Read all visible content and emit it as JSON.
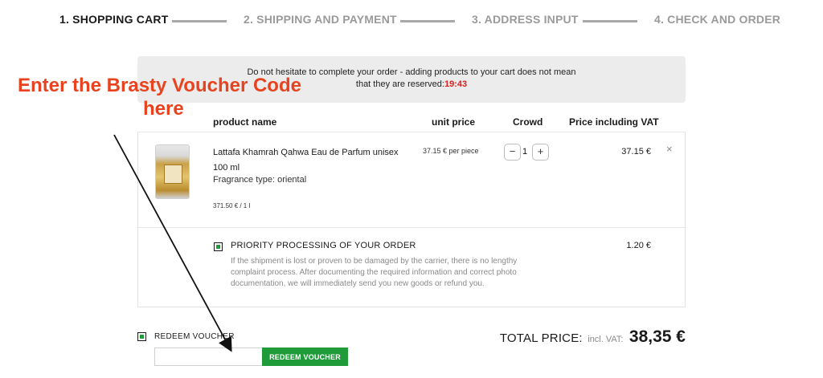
{
  "steps": [
    {
      "label": "1. SHOPPING CART"
    },
    {
      "label": "2. SHIPPING AND PAYMENT"
    },
    {
      "label": "3. ADDRESS INPUT"
    },
    {
      "label": "4. CHECK AND ORDER"
    }
  ],
  "notice": {
    "line1": "Do not hesitate to complete your order - adding products to your cart does not mean",
    "line2": "that they are reserved:",
    "timer": "19:43"
  },
  "annotation": {
    "line1": "Enter the Brasty Voucher Code",
    "line2": "here"
  },
  "table_headers": {
    "product_name": "product name",
    "unit_price": "unit price",
    "crowd": "Crowd",
    "price_incl_vat": "Price including VAT"
  },
  "product": {
    "name": "Lattafa Khamrah Qahwa Eau de Parfum unisex 100 ml",
    "fragrance": "Fragrance type: oriental",
    "unit_note": "371.50 € / 1 l",
    "unit_price": "37.15 € per piece",
    "quantity": "1",
    "minus": "−",
    "plus": "+",
    "total": "37.15 €",
    "remove": "×"
  },
  "priority": {
    "title": "PRIORITY PROCESSING OF YOUR ORDER",
    "description": "If the shipment is lost or proven to be damaged by the carrier, there is no lengthy complaint process. After documenting the required information and correct photo documentation, we will immediately send you new goods or refund you.",
    "price": "1.20 €"
  },
  "voucher": {
    "label": "REDEEM VOUCHER",
    "input_value": "",
    "button_label": "REDEEM VOUCHER"
  },
  "total": {
    "label": "TOTAL PRICE:",
    "vat_note": "incl. VAT:",
    "amount": "38,35 €"
  },
  "colors": {
    "accent_green": "#1f9b3a",
    "annotation_orange": "#e8431e",
    "timer_red": "#e01e1e"
  }
}
